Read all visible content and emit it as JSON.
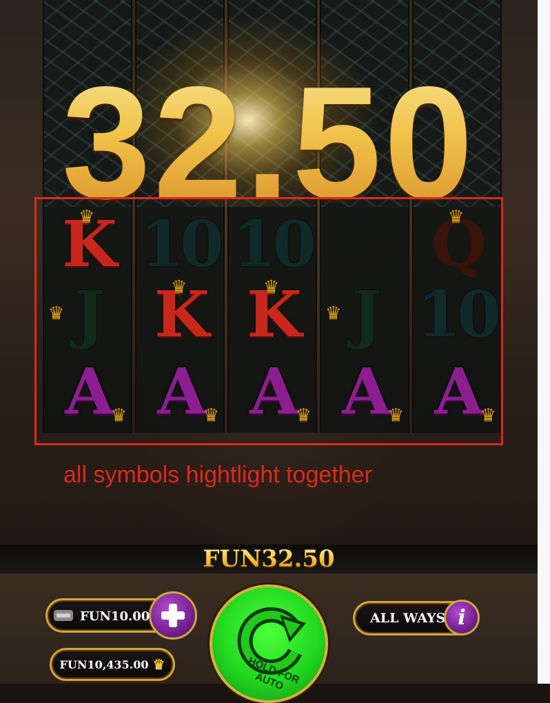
{
  "win_display": {
    "amount": "32.50"
  },
  "annotation": {
    "text": "all symbols hightlight together"
  },
  "reels": [
    {
      "symbols": [
        {
          "glyph": "K",
          "kind": "k",
          "crown": true,
          "dim": false
        },
        {
          "glyph": "J",
          "kind": "j",
          "crown": true
        },
        {
          "glyph": "A",
          "kind": "a",
          "crown": true
        }
      ]
    },
    {
      "symbols": [
        {
          "glyph": "10",
          "kind": "ten"
        },
        {
          "glyph": "K",
          "kind": "k",
          "crown": true
        },
        {
          "glyph": "A",
          "kind": "a",
          "crown": true
        }
      ]
    },
    {
      "symbols": [
        {
          "glyph": "10",
          "kind": "ten"
        },
        {
          "glyph": "K",
          "kind": "k",
          "crown": true
        },
        {
          "glyph": "A",
          "kind": "a",
          "crown": true
        }
      ]
    },
    {
      "symbols": [
        {
          "glyph": "",
          "kind": "blank"
        },
        {
          "glyph": "J",
          "kind": "j",
          "crown": true
        },
        {
          "glyph": "A",
          "kind": "a",
          "crown": true
        }
      ]
    },
    {
      "symbols": [
        {
          "glyph": "Q",
          "kind": "q",
          "crown": true
        },
        {
          "glyph": "10",
          "kind": "ten"
        },
        {
          "glyph": "A",
          "kind": "a",
          "crown": true
        }
      ]
    }
  ],
  "win_bar": {
    "text": "FUN32.50"
  },
  "controls": {
    "bet_label": "FUN10.00",
    "balance_label": "FUN10,435.00",
    "spin_text": "HOLD FOR AUTO",
    "all_ways_label": "ALL WAYS",
    "info_label": "i"
  },
  "icons": {
    "crown": "crown-icon",
    "plus": "plus-icon",
    "minus": "minus-icon",
    "spin": "refresh-arrow-icon",
    "info": "info-icon"
  },
  "colors": {
    "win_gold": "#f0c34a",
    "annotation_red": "#e0281b",
    "spin_green": "#22d91f",
    "button_purple": "#8b2aa6"
  }
}
